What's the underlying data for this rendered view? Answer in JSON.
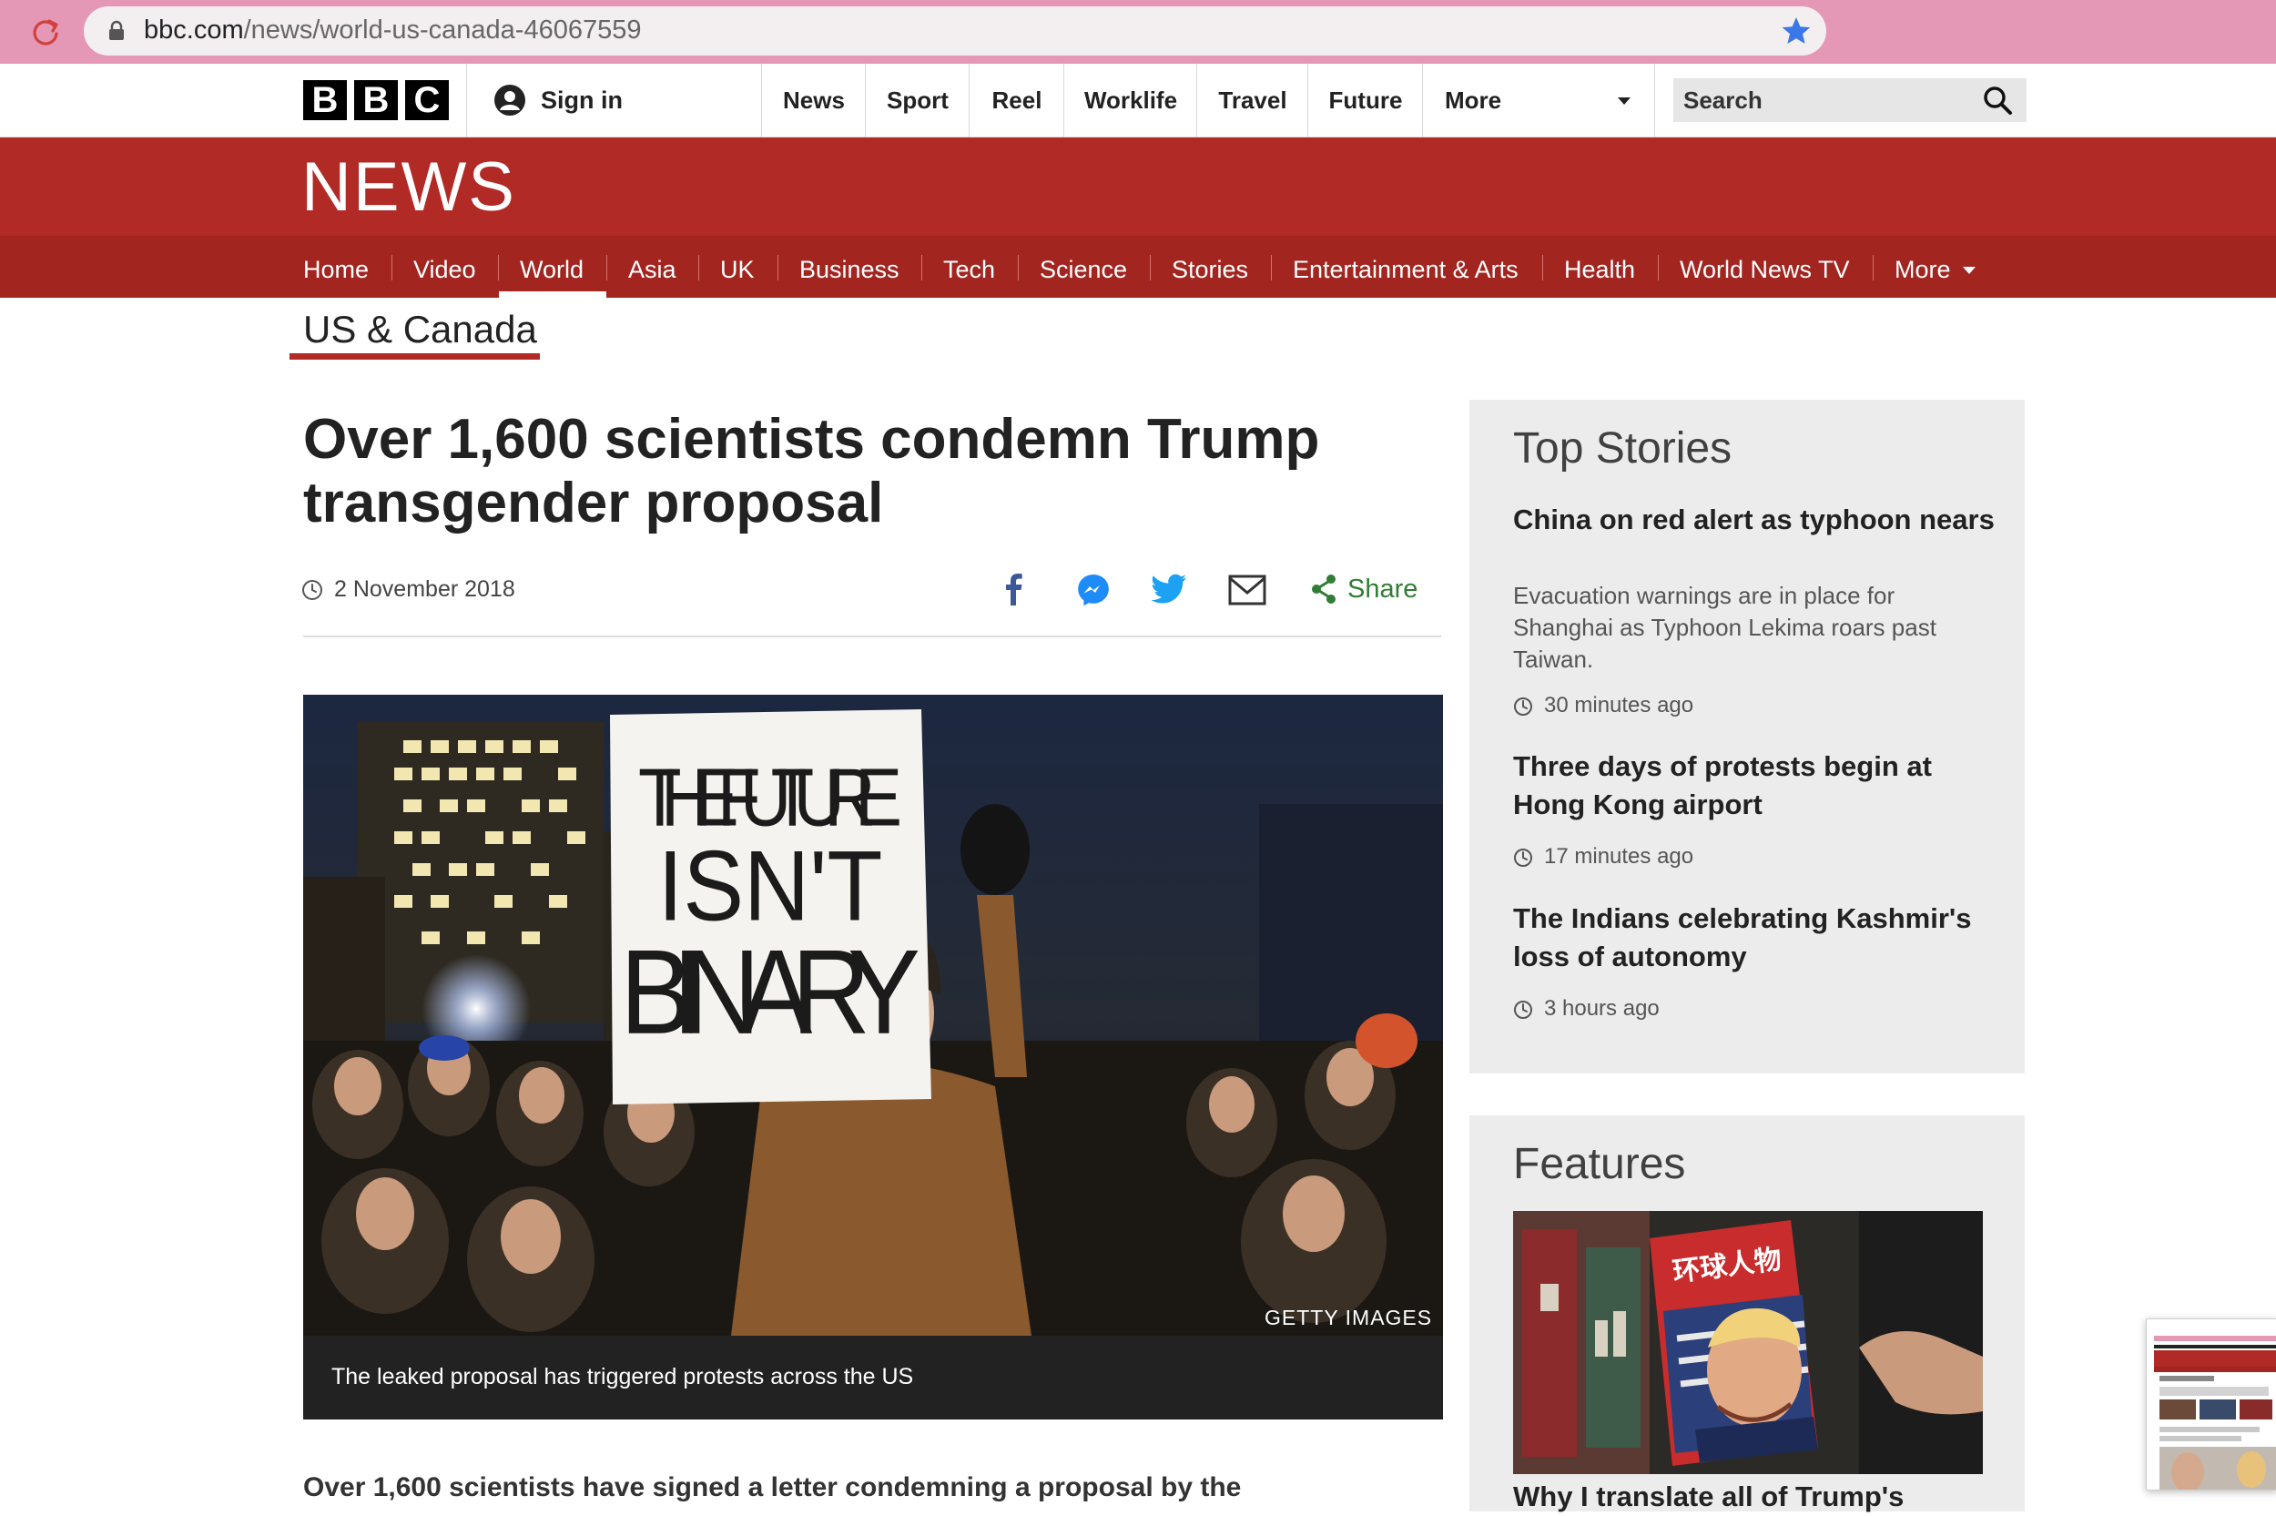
{
  "browser": {
    "url_domain": "bbc.com",
    "url_path": "/news/world-us-canada-46067559"
  },
  "global_nav": {
    "logo_letters": [
      "B",
      "B",
      "C"
    ],
    "sign_in": "Sign in",
    "items": [
      "News",
      "Sport",
      "Reel",
      "Worklife",
      "Travel",
      "Future",
      "More"
    ],
    "search_placeholder": "Search"
  },
  "news_nav": {
    "wordmark": "NEWS",
    "items": [
      "Home",
      "Video",
      "World",
      "Asia",
      "UK",
      "Business",
      "Tech",
      "Science",
      "Stories",
      "Entertainment & Arts",
      "Health",
      "World News TV",
      "More"
    ],
    "active_item": "World"
  },
  "section": "US & Canada",
  "article": {
    "headline": "Over 1,600 scientists condemn Trump transgender proposal",
    "date": "2 November 2018",
    "share_label": "Share",
    "photo_sign_lines": [
      "THE FUTURE",
      "ISN'T",
      "BINARY"
    ],
    "photo_credit": "GETTY IMAGES",
    "caption": "The leaked proposal has triggered protests across the US",
    "lede": "Over 1,600 scientists have signed a letter condemning a proposal by the"
  },
  "top_stories": {
    "title": "Top Stories",
    "items": [
      {
        "headline": "China on red alert as typhoon nears",
        "summary": "Evacuation warnings are in place for Shanghai as Typhoon Lekima roars past Taiwan.",
        "time": "30 minutes ago"
      },
      {
        "headline": "Three days of protests begin at Hong Kong airport",
        "time": "17 minutes ago"
      },
      {
        "headline": "The Indians celebrating Kashmir's loss of autonomy",
        "time": "3 hours ago"
      }
    ]
  },
  "features": {
    "title": "Features",
    "headline": "Why I translate all of Trump's",
    "magazine_title": "环球人物"
  },
  "colors": {
    "bbc_red": "#b12a25",
    "nav_red": "#a22520",
    "share_green": "#307d36",
    "browser_bar": "#e597b6"
  }
}
